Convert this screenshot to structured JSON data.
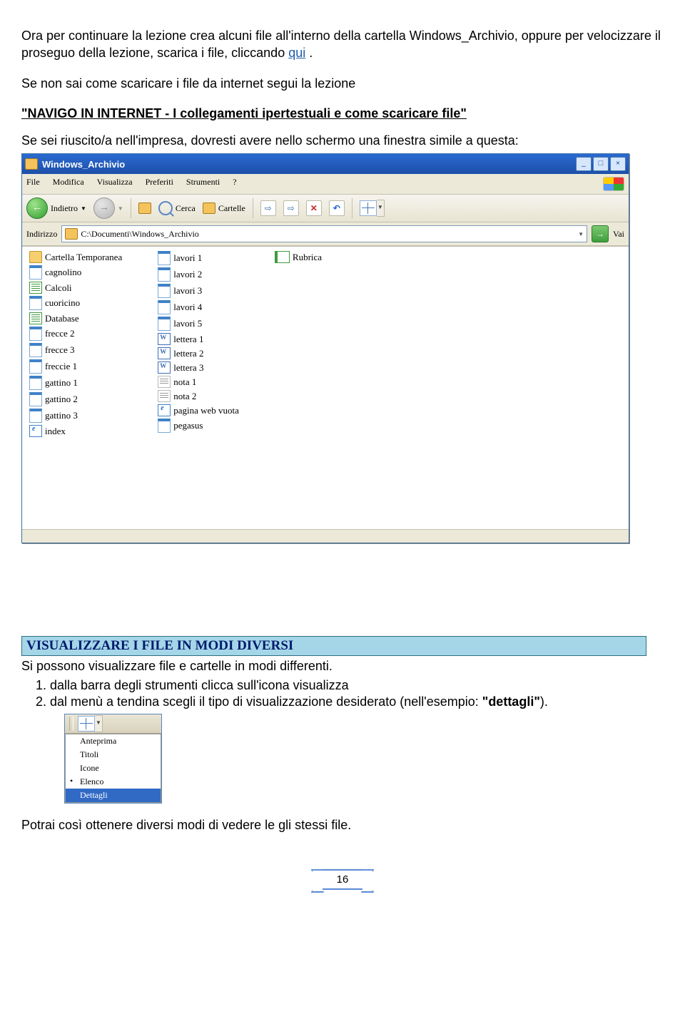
{
  "intro": {
    "p1a": "Ora per continuare la lezione crea alcuni file all'interno della cartella Windows_Archivio, oppure per velocizzare il proseguo della lezione, scarica i file, cliccando ",
    "qui": "qui",
    "dot": " .",
    "p2a": "Se non sai come scaricare i file da internet segui la lezione",
    "p2b": "\"NAVIGO IN INTERNET - I collegamenti ipertestuali e come scaricare file\"",
    "p3": "Se sei riuscito/a nell'impresa, dovresti avere nello schermo una finestra simile a questa:"
  },
  "explorer": {
    "title": "Windows_Archivio",
    "menus": [
      "File",
      "Modifica",
      "Visualizza",
      "Preferiti",
      "Strumenti",
      "?"
    ],
    "back": "Indietro",
    "search": "Cerca",
    "folders": "Cartelle",
    "addr_label": "Indirizzo",
    "addr_path": "C:\\Documenti\\Windows_Archivio",
    "go": "Vai",
    "col1": [
      {
        "t": "fold",
        "n": "Cartella Temporanea"
      },
      {
        "t": "img",
        "n": "cagnolino"
      },
      {
        "t": "xls",
        "n": "Calcoli"
      },
      {
        "t": "img",
        "n": "cuoricino"
      },
      {
        "t": "xls",
        "n": "Database"
      },
      {
        "t": "img",
        "n": "frecce 2"
      },
      {
        "t": "img",
        "n": "frecce 3"
      },
      {
        "t": "img",
        "n": "freccie 1"
      },
      {
        "t": "img",
        "n": "gattino 1"
      },
      {
        "t": "img",
        "n": "gattino 2"
      },
      {
        "t": "img",
        "n": "gattino 3"
      },
      {
        "t": "htm",
        "n": "index"
      }
    ],
    "col2": [
      {
        "t": "img",
        "n": "lavori 1"
      },
      {
        "t": "img",
        "n": "lavori 2"
      },
      {
        "t": "img",
        "n": "lavori 3"
      },
      {
        "t": "img",
        "n": "lavori 4"
      },
      {
        "t": "img",
        "n": "lavori 5"
      },
      {
        "t": "doc",
        "n": "lettera 1"
      },
      {
        "t": "doc",
        "n": "lettera 2"
      },
      {
        "t": "doc",
        "n": "lettera 3"
      },
      {
        "t": "txt",
        "n": "nota 1"
      },
      {
        "t": "txt",
        "n": "nota 2"
      },
      {
        "t": "htm",
        "n": "pagina web vuota"
      },
      {
        "t": "img",
        "n": "pegasus"
      }
    ],
    "col3": [
      {
        "t": "wab",
        "n": "Rubrica"
      }
    ]
  },
  "section": {
    "title": "VISUALIZZARE I FILE IN MODI DIVERSI",
    "lead": "Si possono visualizzare file e cartelle in modi differenti.",
    "li1": "dalla barra degli strumenti clicca sull'icona visualizza",
    "li2a": "dal menù a tendina scegli il tipo di visualizzazione desiderato (nell'esempio: ",
    "li2b": "\"dettagli\"",
    "li2c": ")."
  },
  "views_menu": [
    "Anteprima",
    "Titoli",
    "Icone",
    "Elenco",
    "Dettagli"
  ],
  "after": "Potrai così ottenere diversi modi di vedere le gli stessi file.",
  "page": "16"
}
